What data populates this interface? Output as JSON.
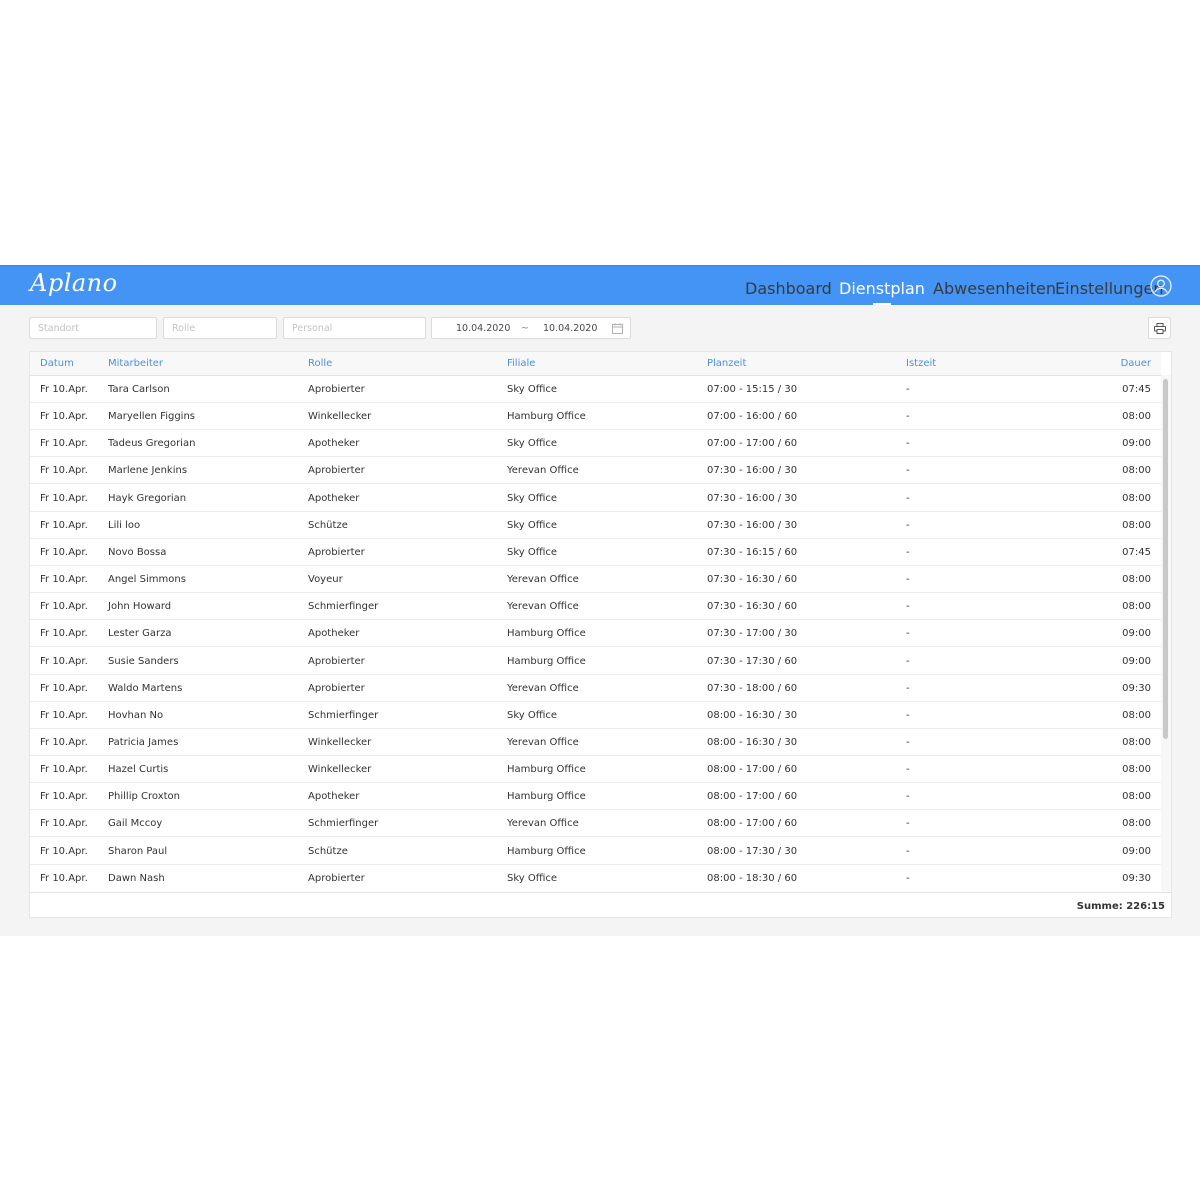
{
  "app": {
    "logo": "Aplano"
  },
  "nav": [
    {
      "label": "Dashboard",
      "active": false
    },
    {
      "label": "Dienstplan",
      "active": true
    },
    {
      "label": "Abwesenheiten",
      "active": false
    },
    {
      "label": "Einstellungen",
      "active": false
    }
  ],
  "filters": {
    "standort_placeholder": "Standort",
    "rolle_placeholder": "Rolle",
    "personal_placeholder": "Personal",
    "date_from": "10.04.2020",
    "date_sep": "~",
    "date_to": "10.04.2020"
  },
  "table": {
    "headers": {
      "datum": "Datum",
      "mitarbeiter": "Mitarbeiter",
      "rolle": "Rolle",
      "filiale": "Filiale",
      "planzeit": "Planzeit",
      "istzeit": "Istzeit",
      "dauer": "Dauer"
    },
    "rows": [
      {
        "datum": "Fr 10.Apr.",
        "mitarbeiter": "Tara Carlson",
        "rolle": "Aprobierter",
        "filiale": "Sky Office",
        "planzeit": "07:00 - 15:15 / 30",
        "istzeit": "-",
        "dauer": "07:45"
      },
      {
        "datum": "Fr 10.Apr.",
        "mitarbeiter": "Maryellen Figgins",
        "rolle": "Winkellecker",
        "filiale": "Hamburg Office",
        "planzeit": "07:00 - 16:00 / 60",
        "istzeit": "-",
        "dauer": "08:00"
      },
      {
        "datum": "Fr 10.Apr.",
        "mitarbeiter": "Tadeus Gregorian",
        "rolle": "Apotheker",
        "filiale": "Sky Office",
        "planzeit": "07:00 - 17:00 / 60",
        "istzeit": "-",
        "dauer": "09:00"
      },
      {
        "datum": "Fr 10.Apr.",
        "mitarbeiter": "Marlene Jenkins",
        "rolle": "Aprobierter",
        "filiale": "Yerevan Office",
        "planzeit": "07:30 - 16:00 / 30",
        "istzeit": "-",
        "dauer": "08:00"
      },
      {
        "datum": "Fr 10.Apr.",
        "mitarbeiter": "Hayk Gregorian",
        "rolle": "Apotheker",
        "filiale": "Sky Office",
        "planzeit": "07:30 - 16:00 / 30",
        "istzeit": "-",
        "dauer": "08:00"
      },
      {
        "datum": "Fr 10.Apr.",
        "mitarbeiter": "Lili loo",
        "rolle": "Schütze",
        "filiale": "Sky Office",
        "planzeit": "07:30 - 16:00 / 30",
        "istzeit": "-",
        "dauer": "08:00"
      },
      {
        "datum": "Fr 10.Apr.",
        "mitarbeiter": "Novo Bossa",
        "rolle": "Aprobierter",
        "filiale": "Sky Office",
        "planzeit": "07:30 - 16:15 / 60",
        "istzeit": "-",
        "dauer": "07:45"
      },
      {
        "datum": "Fr 10.Apr.",
        "mitarbeiter": "Angel Simmons",
        "rolle": "Voyeur",
        "filiale": "Yerevan Office",
        "planzeit": "07:30 - 16:30 / 60",
        "istzeit": "-",
        "dauer": "08:00"
      },
      {
        "datum": "Fr 10.Apr.",
        "mitarbeiter": "John Howard",
        "rolle": "Schmierfinger",
        "filiale": "Yerevan Office",
        "planzeit": "07:30 - 16:30 / 60",
        "istzeit": "-",
        "dauer": "08:00"
      },
      {
        "datum": "Fr 10.Apr.",
        "mitarbeiter": "Lester Garza",
        "rolle": "Apotheker",
        "filiale": "Hamburg Office",
        "planzeit": "07:30 - 17:00 / 30",
        "istzeit": "-",
        "dauer": "09:00"
      },
      {
        "datum": "Fr 10.Apr.",
        "mitarbeiter": "Susie Sanders",
        "rolle": "Aprobierter",
        "filiale": "Hamburg Office",
        "planzeit": "07:30 - 17:30 / 60",
        "istzeit": "-",
        "dauer": "09:00"
      },
      {
        "datum": "Fr 10.Apr.",
        "mitarbeiter": "Waldo Martens",
        "rolle": "Aprobierter",
        "filiale": "Yerevan Office",
        "planzeit": "07:30 - 18:00 / 60",
        "istzeit": "-",
        "dauer": "09:30"
      },
      {
        "datum": "Fr 10.Apr.",
        "mitarbeiter": "Hovhan No",
        "rolle": "Schmierfinger",
        "filiale": "Sky Office",
        "planzeit": "08:00 - 16:30 / 30",
        "istzeit": "-",
        "dauer": "08:00"
      },
      {
        "datum": "Fr 10.Apr.",
        "mitarbeiter": "Patricia James",
        "rolle": "Winkellecker",
        "filiale": "Yerevan Office",
        "planzeit": "08:00 - 16:30 / 30",
        "istzeit": "-",
        "dauer": "08:00"
      },
      {
        "datum": "Fr 10.Apr.",
        "mitarbeiter": "Hazel Curtis",
        "rolle": "Winkellecker",
        "filiale": "Hamburg Office",
        "planzeit": "08:00 - 17:00 / 60",
        "istzeit": "-",
        "dauer": "08:00"
      },
      {
        "datum": "Fr 10.Apr.",
        "mitarbeiter": "Phillip Croxton",
        "rolle": "Apotheker",
        "filiale": "Hamburg Office",
        "planzeit": "08:00 - 17:00 / 60",
        "istzeit": "-",
        "dauer": "08:00"
      },
      {
        "datum": "Fr 10.Apr.",
        "mitarbeiter": "Gail Mccoy",
        "rolle": "Schmierfinger",
        "filiale": "Yerevan Office",
        "planzeit": "08:00 - 17:00 / 60",
        "istzeit": "-",
        "dauer": "08:00"
      },
      {
        "datum": "Fr 10.Apr.",
        "mitarbeiter": "Sharon Paul",
        "rolle": "Schütze",
        "filiale": "Hamburg Office",
        "planzeit": "08:00 - 17:30 / 30",
        "istzeit": "-",
        "dauer": "09:00"
      },
      {
        "datum": "Fr 10.Apr.",
        "mitarbeiter": "Dawn Nash",
        "rolle": "Aprobierter",
        "filiale": "Sky Office",
        "planzeit": "08:00 - 18:30 / 60",
        "istzeit": "-",
        "dauer": "09:30"
      }
    ],
    "summe": "Summe: 226:15"
  },
  "colors": {
    "topbar": "#4494f5",
    "header_text": "#4a90e2"
  }
}
